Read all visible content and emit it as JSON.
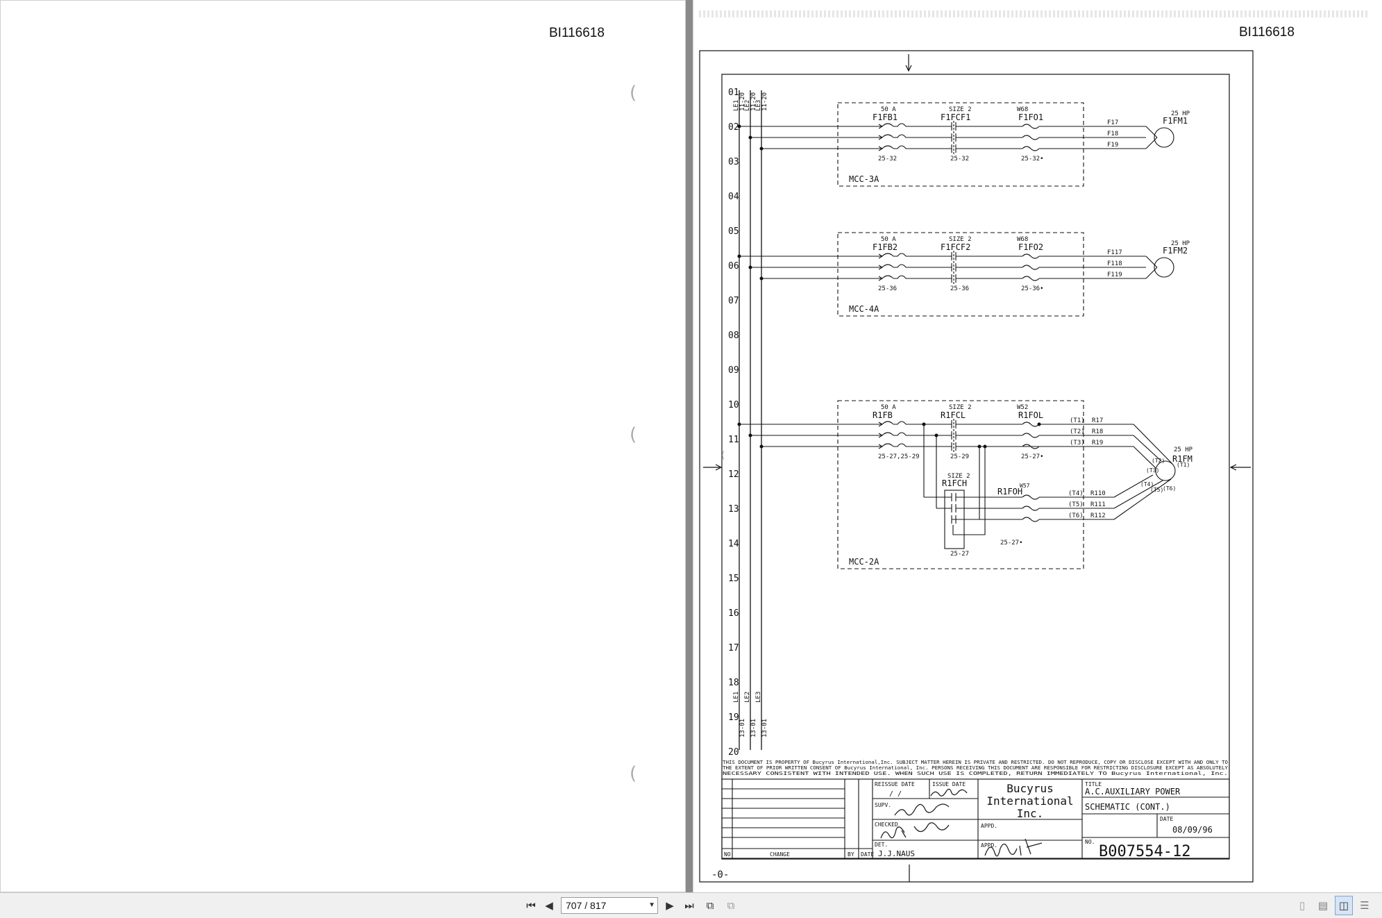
{
  "left_page": {
    "doc_id": "BI116618"
  },
  "right_page": {
    "doc_id": "BI116618",
    "rows": [
      "01",
      "02",
      "03",
      "04",
      "05",
      "06",
      "07",
      "08",
      "09",
      "10",
      "11",
      "12",
      "13",
      "14",
      "15",
      "16",
      "17",
      "18",
      "19",
      "20"
    ],
    "bus_labels_top": [
      "LE1",
      "LE2",
      "LE3"
    ],
    "bus_refs_top": [
      "11-20",
      "11-20",
      "11-20"
    ],
    "bus_labels_bottom": [
      "LE1",
      "LE2",
      "LE3"
    ],
    "bus_refs_bottom": [
      "13-01",
      "13-01",
      "13-01"
    ],
    "circuits": [
      {
        "panel": "MCC-3A",
        "breaker_rating": "50 A",
        "breaker": "F1FB1",
        "contactor_size": "SIZE 2",
        "contactor": "F1FCF1",
        "overload_heater": "W68",
        "overload": "F1FO1",
        "ref_breaker": "25-32",
        "ref_contactor": "25-32",
        "ref_overload": "25-32•",
        "wires": [
          "F17",
          "F18",
          "F19"
        ],
        "motor_hp": "25 HP",
        "motor": "F1FM1"
      },
      {
        "panel": "MCC-4A",
        "breaker_rating": "50 A",
        "breaker": "F1FB2",
        "contactor_size": "SIZE 2",
        "contactor": "F1FCF2",
        "overload_heater": "W68",
        "overload": "F1FO2",
        "ref_breaker": "25-36",
        "ref_contactor": "25-36",
        "ref_overload": "25-36•",
        "wires": [
          "F117",
          "F118",
          "F119"
        ],
        "motor_hp": "25 HP",
        "motor": "F1FM2"
      },
      {
        "panel": "MCC-2A",
        "breaker_rating": "50 A",
        "breaker": "R1FB",
        "contactor_size": "SIZE 2",
        "contactor": "R1FCL",
        "overload_heater": "W52",
        "overload": "R1FOL",
        "ref_breaker": "25-27,25-29",
        "ref_contactor": "25-29",
        "ref_overload": "25-27•",
        "high_contactor_size": "SIZE 2",
        "high_contactor": "R1FCH",
        "high_overload_heater": "W57",
        "high_overload": "R1FOH",
        "ref_high_contactor": "25-27",
        "ref_high_overload": "25-27•",
        "terminals_low": [
          "(T1)",
          "(T2)",
          "(T3)"
        ],
        "wires_low": [
          "R17",
          "R18",
          "R19"
        ],
        "terminals_high": [
          "(T4)",
          "(T5)",
          "(T6)"
        ],
        "wires_high": [
          "R110",
          "R111",
          "R112"
        ],
        "motor_terminals": [
          "(T1)",
          "(T2)",
          "(T3)",
          "(T4)",
          "(T5)",
          "(T6)"
        ],
        "motor_hp": "25 HP",
        "motor": "R1FM"
      }
    ],
    "notice": "THIS DOCUMENT IS PROPERTY OF Bucyrus International,Inc. SUBJECT MATTER HEREIN IS PRIVATE AND RESTRICTED. DO NOT REPRODUCE, COPY OR DISCLOSE EXCEPT WITH AND ONLY TO THE EXTENT OF PRIOR WRITTEN CONSENT OF Bucyrus International, Inc. PERSONS RECEIVING THIS DOCUMENT ARE RESPONSIBLE FOR RESTRICTING DISCLOSURE EXCEPT AS ABSOLUTELY NECESSARY CONSISTENT WITH INTENDED USE. WHEN SUCH USE IS COMPLETED, RETURN IMMEDIATELY TO Bucyrus International, Inc.",
    "title_block": {
      "col_no": "NO",
      "col_change": "CHANGE",
      "col_by": "BY",
      "col_date": "DATE",
      "reissue_date_label": "REISSUE DATE",
      "reissue_date_value": "/ /",
      "issue_date_label": "ISSUE DATE",
      "supv_label": "SUPV.",
      "checked_label": "CHECKED",
      "det_label": "DET.",
      "det_value": "J.J.NAUS",
      "appd_label": "APPD.",
      "appd_label_2": "APPD.",
      "company_line1": "Bucyrus",
      "company_line2": "International",
      "company_line3": "Inc.",
      "title_label": "TITLE",
      "title_line1": "A.C.AUXILIARY POWER",
      "title_line2": "SCHEMATIC (CONT.)",
      "date_label": "DATE",
      "date_value": "08/09/96",
      "no_label": "NO.",
      "drawing_no": "B007554-12"
    },
    "revision_mark": "-0-"
  },
  "toolbar": {
    "page_field": "707 / 817",
    "buttons": [
      "first-page",
      "previous-page",
      "next-page",
      "last-page",
      "previous-view",
      "next-view",
      "single-page-view",
      "continuous-view",
      "facing-view",
      "continuous-facing-view"
    ]
  }
}
